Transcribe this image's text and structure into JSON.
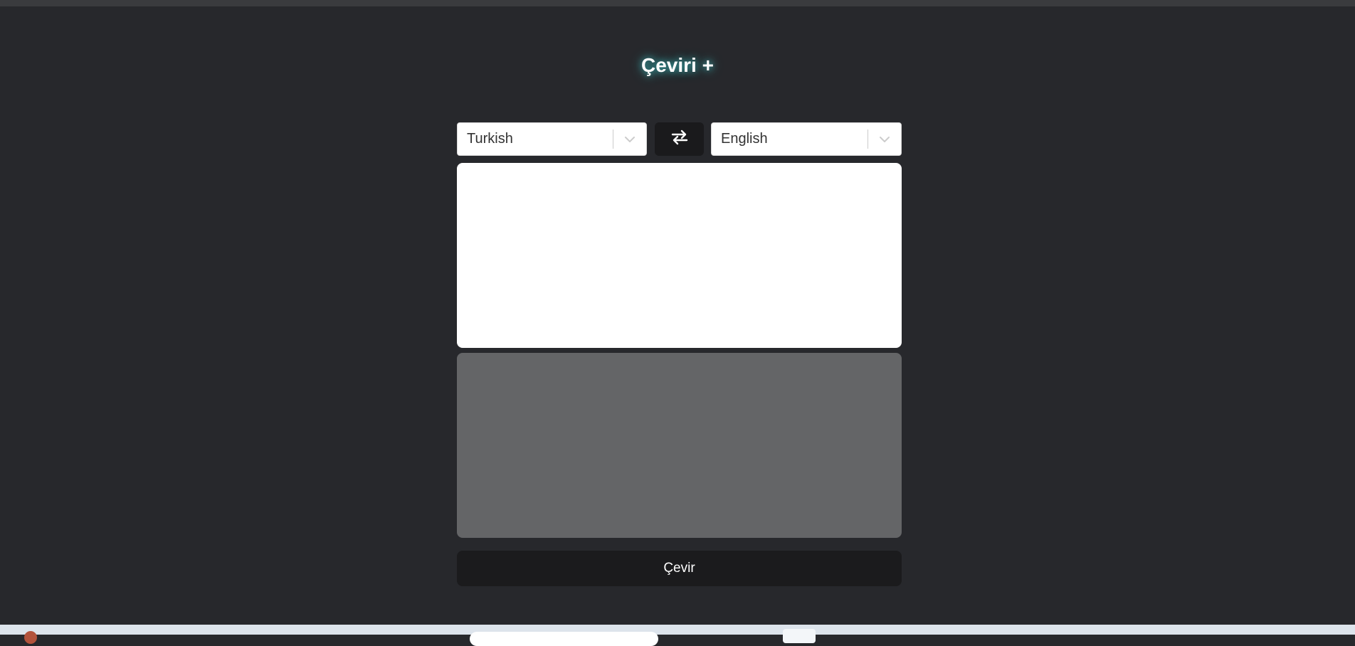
{
  "app": {
    "title": "Çeviri +"
  },
  "translator": {
    "source_language": "Turkish",
    "target_language": "English",
    "source_text": "",
    "output_text": "",
    "translate_label": "Çevir"
  },
  "icons": {
    "swap": "swap-arrows-icon",
    "dropdown": "chevron-down-icon"
  },
  "colors": {
    "background": "#27282c",
    "title_glow": "#40e0e0",
    "button_dark": "#1b1b1d",
    "output_panel": "#646567"
  }
}
